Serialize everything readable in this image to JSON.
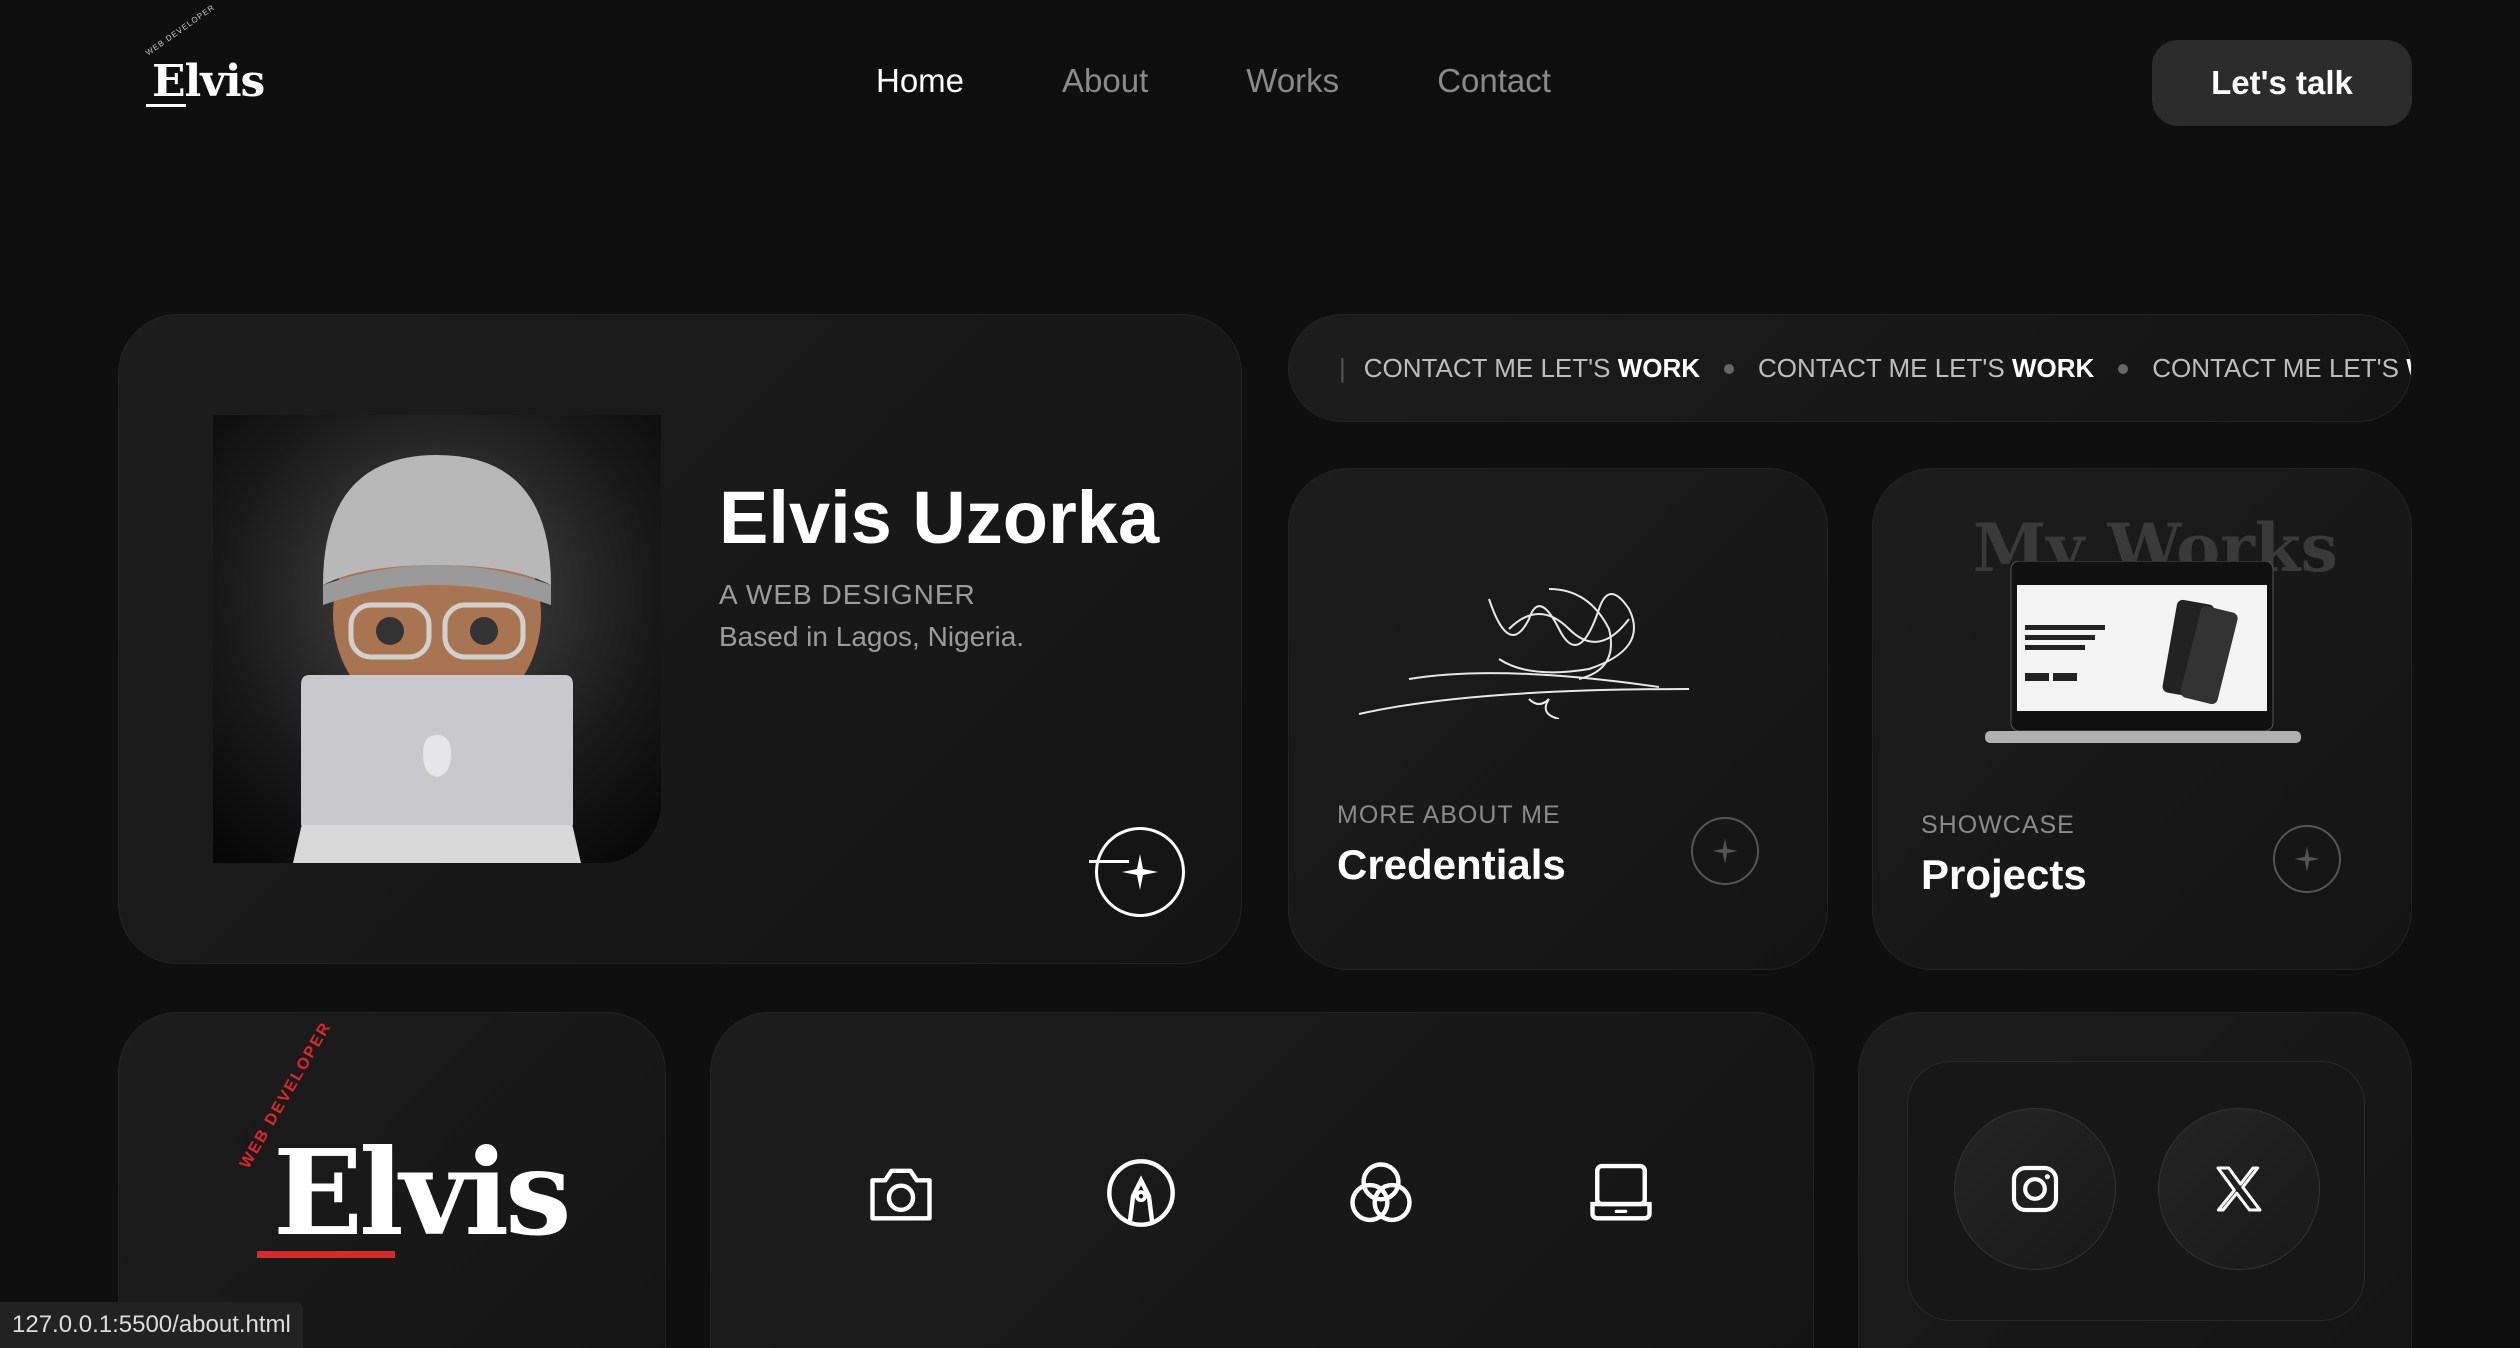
{
  "nav": {
    "logo_text": "Elvis",
    "logo_tag": "WEB DEVELOPER",
    "links": [
      "Home",
      "About",
      "Works",
      "Contact"
    ],
    "cta": "Let's talk"
  },
  "profile": {
    "name": "Elvis Uzorka",
    "role": "A WEB DESIGNER",
    "location": "Based in Lagos, Nigeria."
  },
  "marquee": {
    "items": [
      {
        "text": "CONTACT ME LET'S ",
        "bold": "WORK"
      },
      {
        "text": "CONTACT ME LET'S ",
        "bold": "WORK"
      },
      {
        "text": "CONTACT ME LET'S ",
        "bold": "WO"
      }
    ]
  },
  "credentials": {
    "sub": "MORE ABOUT ME",
    "title": "Credentials"
  },
  "projects": {
    "sub": "SHOWCASE",
    "title": "Projects",
    "bg_text": "My Works"
  },
  "brand": {
    "text": "Elvis",
    "tag": "WEB DEVELOPER",
    "accent": "#e0262b"
  },
  "icons": [
    "camera-icon",
    "pen-tool-icon",
    "color-circles-icon",
    "laptop-icon"
  ],
  "social": [
    "instagram-icon",
    "x-icon"
  ],
  "status_url": "127.0.0.1:5500/about.html"
}
